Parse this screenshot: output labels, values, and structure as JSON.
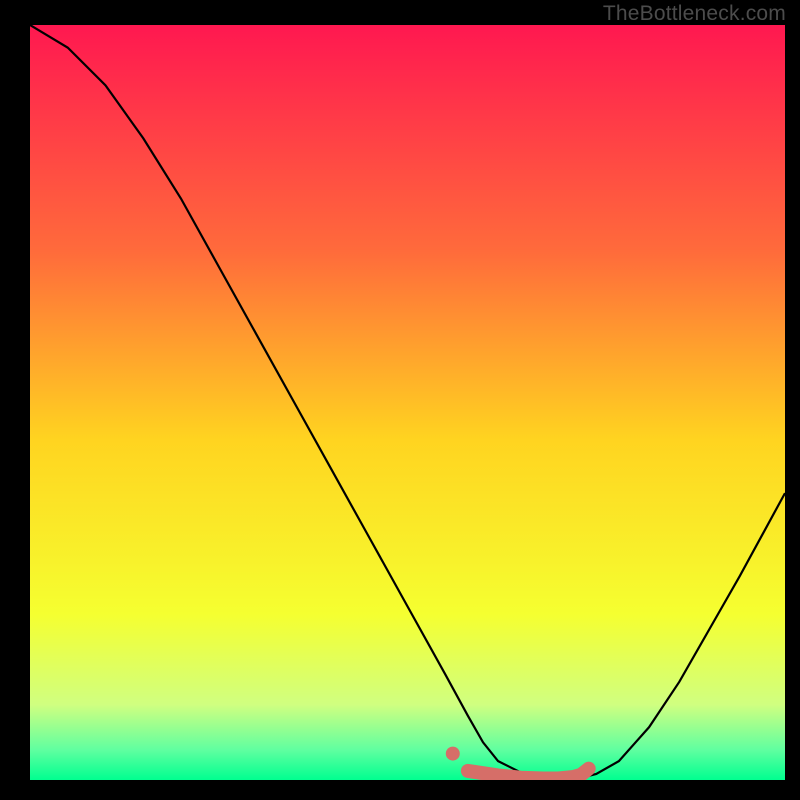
{
  "watermark": "TheBottleneck.com",
  "chart_data": {
    "type": "line",
    "title": "",
    "xlabel": "",
    "ylabel": "",
    "xlim": [
      0,
      100
    ],
    "ylim": [
      0,
      100
    ],
    "series": [
      {
        "name": "bottleneck-curve",
        "color": "#000000",
        "x": [
          0,
          5,
          10,
          15,
          20,
          25,
          30,
          35,
          40,
          45,
          50,
          55,
          58,
          60,
          62,
          65,
          68,
          70,
          73,
          75,
          78,
          82,
          86,
          90,
          94,
          100
        ],
        "y": [
          100,
          97,
          92,
          85,
          77,
          68,
          59,
          50,
          41,
          32,
          23,
          14,
          8.5,
          5,
          2.5,
          1,
          0.4,
          0.2,
          0.3,
          0.8,
          2.5,
          7,
          13,
          20,
          27,
          38
        ]
      },
      {
        "name": "highlight-marker",
        "color": "#d66e68",
        "type": "marker",
        "x": [
          58,
          62,
          65,
          68,
          70,
          72,
          73,
          74
        ],
        "y": [
          1.2,
          0.6,
          0.3,
          0.2,
          0.2,
          0.4,
          0.7,
          1.5
        ]
      }
    ],
    "gradient_stops": [
      {
        "offset": 0,
        "color": "#ff1850"
      },
      {
        "offset": 30,
        "color": "#ff6b3b"
      },
      {
        "offset": 55,
        "color": "#ffd420"
      },
      {
        "offset": 78,
        "color": "#f5ff30"
      },
      {
        "offset": 90,
        "color": "#d0ff80"
      },
      {
        "offset": 96,
        "color": "#60ffa0"
      },
      {
        "offset": 100,
        "color": "#00ff90"
      }
    ]
  }
}
